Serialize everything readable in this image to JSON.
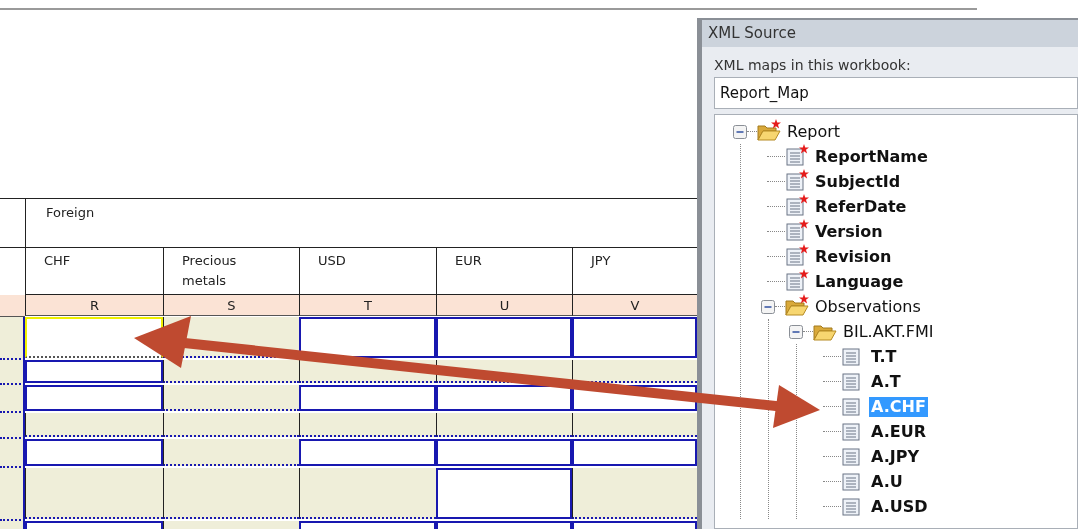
{
  "sheet": {
    "group_header": "Foreign",
    "columns": [
      {
        "heading": "CHF",
        "letter": "R"
      },
      {
        "heading": "Precious metals",
        "letter": "S"
      },
      {
        "heading": "USD",
        "letter": "T"
      },
      {
        "heading": "EUR",
        "letter": "U"
      },
      {
        "heading": "JPY",
        "letter": "V"
      }
    ],
    "rows": [
      [
        {
          "kind": "input",
          "selected": true
        },
        {
          "kind": "shaded",
          "selected": false
        },
        {
          "kind": "input",
          "selected": false
        },
        {
          "kind": "input",
          "selected": false
        },
        {
          "kind": "input",
          "selected": false
        }
      ],
      [
        {
          "kind": "input",
          "selected": false
        },
        {
          "kind": "shaded",
          "selected": false
        },
        {
          "kind": "shaded",
          "selected": false
        },
        {
          "kind": "shaded",
          "selected": false
        },
        {
          "kind": "shaded",
          "selected": false
        }
      ],
      [
        {
          "kind": "input",
          "selected": false
        },
        {
          "kind": "shaded",
          "selected": false
        },
        {
          "kind": "input",
          "selected": false
        },
        {
          "kind": "input",
          "selected": false
        },
        {
          "kind": "input",
          "selected": false
        }
      ],
      [
        {
          "kind": "shaded",
          "selected": false
        },
        {
          "kind": "shaded",
          "selected": false
        },
        {
          "kind": "shaded",
          "selected": false
        },
        {
          "kind": "shaded",
          "selected": false
        },
        {
          "kind": "shaded",
          "selected": false
        }
      ],
      [
        {
          "kind": "input",
          "selected": false
        },
        {
          "kind": "shaded",
          "selected": false
        },
        {
          "kind": "input",
          "selected": false
        },
        {
          "kind": "input",
          "selected": false
        },
        {
          "kind": "input",
          "selected": false
        }
      ],
      [
        {
          "kind": "shaded",
          "selected": false
        },
        {
          "kind": "shaded",
          "selected": false
        },
        {
          "kind": "shaded",
          "selected": false
        },
        {
          "kind": "input",
          "selected": false
        },
        {
          "kind": "shaded",
          "selected": false
        }
      ],
      [
        {
          "kind": "input",
          "selected": false
        },
        {
          "kind": "shaded",
          "selected": false
        },
        {
          "kind": "input",
          "selected": false
        },
        {
          "kind": "input",
          "selected": false
        },
        {
          "kind": "input",
          "selected": false
        }
      ]
    ]
  },
  "xml_source": {
    "title": "XML Source",
    "maps_label": "XML maps in this workbook:",
    "map_value": "Report_Map",
    "tree": [
      {
        "kind": "folder",
        "label": "Report",
        "required": true,
        "expanded": true,
        "selected": false,
        "children": [
          {
            "kind": "element",
            "label": "ReportName",
            "required": true,
            "selected": false
          },
          {
            "kind": "element",
            "label": "SubjectId",
            "required": true,
            "selected": false
          },
          {
            "kind": "element",
            "label": "ReferDate",
            "required": true,
            "selected": false
          },
          {
            "kind": "element",
            "label": "Version",
            "required": true,
            "selected": false
          },
          {
            "kind": "element",
            "label": "Revision",
            "required": true,
            "selected": false
          },
          {
            "kind": "element",
            "label": "Language",
            "required": true,
            "selected": false
          },
          {
            "kind": "folder",
            "label": "Observations",
            "required": true,
            "expanded": true,
            "selected": false,
            "children": [
              {
                "kind": "folder",
                "label": "BIL.AKT.FMI",
                "expanded": true,
                "selected": false,
                "children": [
                  {
                    "kind": "element",
                    "label": "T.T",
                    "selected": false
                  },
                  {
                    "kind": "element",
                    "label": "A.T",
                    "selected": false
                  },
                  {
                    "kind": "element",
                    "label": "A.CHF",
                    "selected": true
                  },
                  {
                    "kind": "element",
                    "label": "A.EUR",
                    "selected": false
                  },
                  {
                    "kind": "element",
                    "label": "A.JPY",
                    "selected": false
                  },
                  {
                    "kind": "element",
                    "label": "A.U",
                    "selected": false
                  },
                  {
                    "kind": "element",
                    "label": "A.USD",
                    "selected": false
                  }
                ]
              }
            ]
          }
        ]
      }
    ]
  }
}
